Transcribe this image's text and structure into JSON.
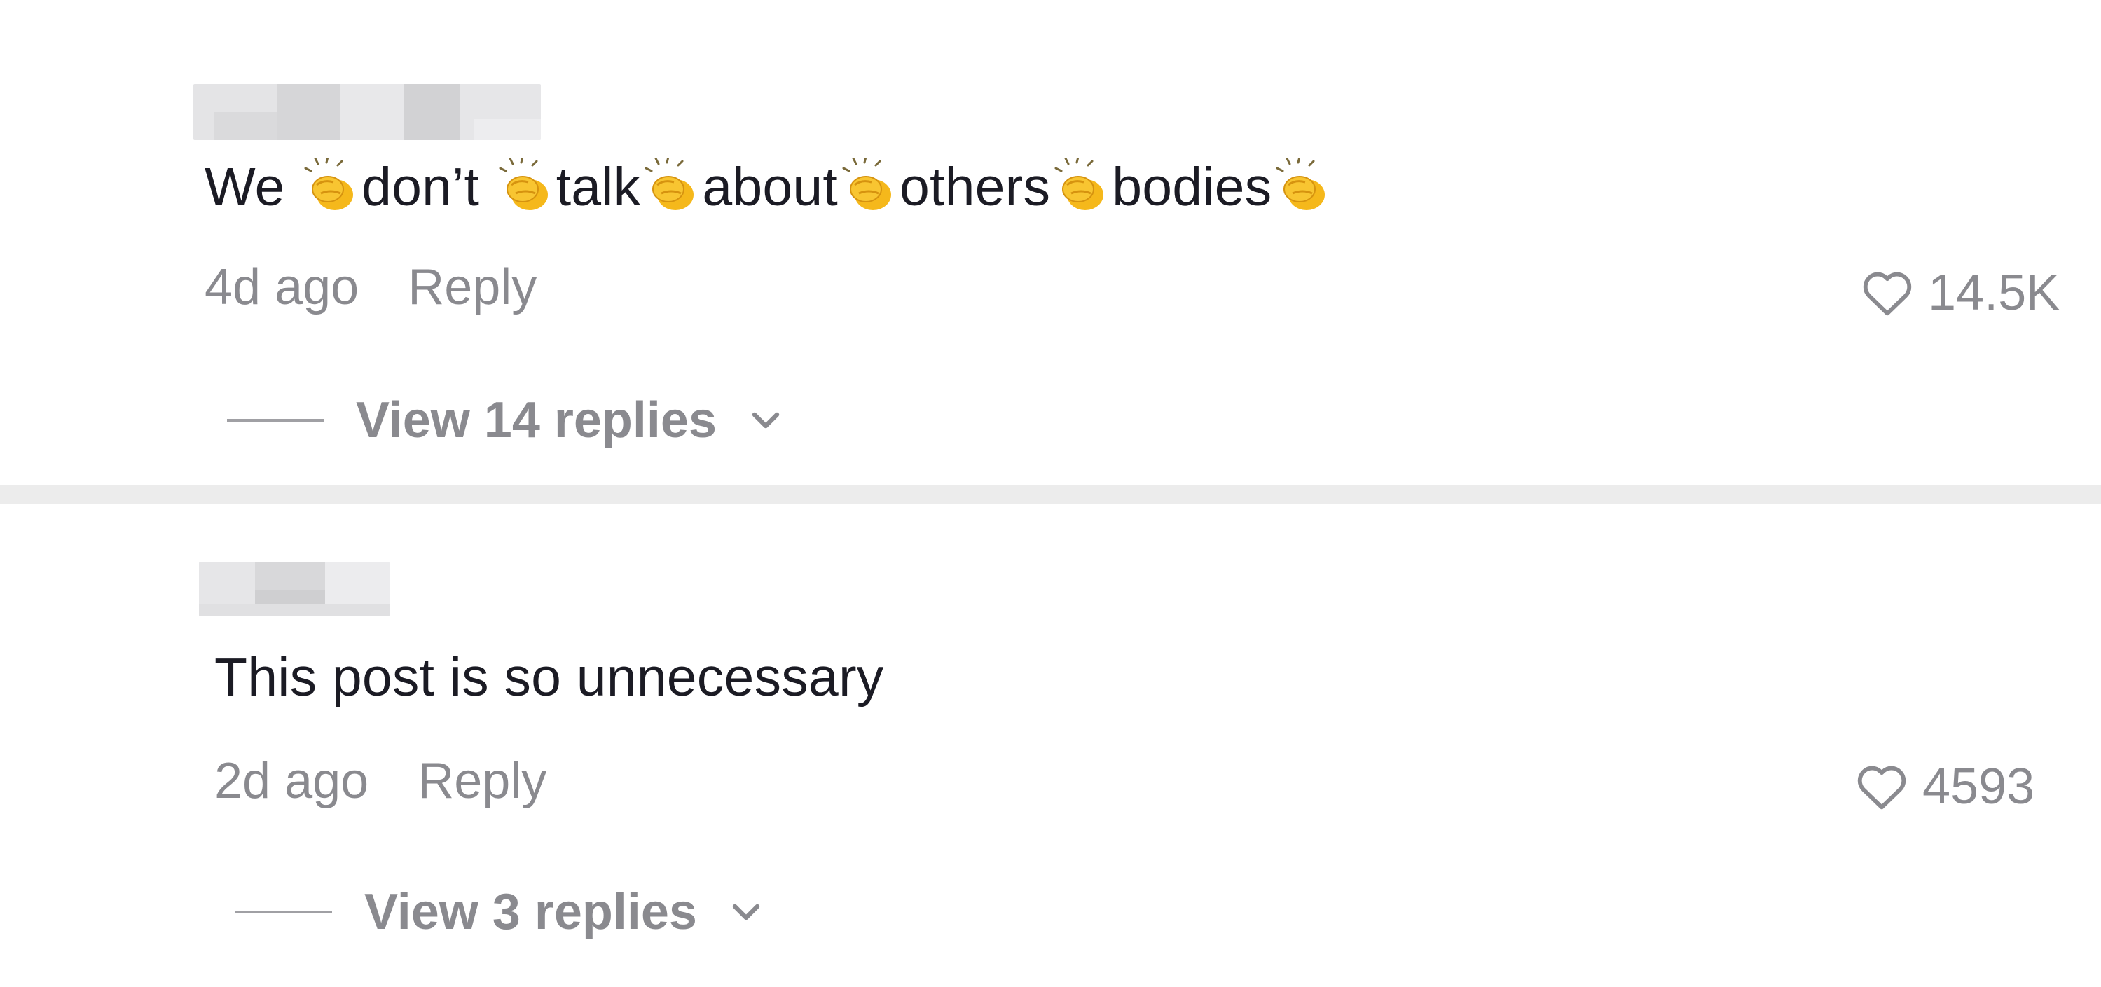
{
  "comments": [
    {
      "text_parts": [
        "We ",
        "don’t ",
        "talk",
        "about",
        "others",
        "bodies",
        ""
      ],
      "time": "4d ago",
      "reply_label": "Reply",
      "likes": "14.5K",
      "view_replies": "View 14 replies"
    },
    {
      "text": "This post is so unnecessary",
      "time": "2d ago",
      "reply_label": "Reply",
      "likes": "4593",
      "view_replies": "View 3 replies"
    }
  ],
  "icons": {
    "clap": "clapping-hands-emoji",
    "like": "heart-outline-icon",
    "expand": "chevron-down-icon"
  },
  "colors": {
    "text": "#1b1b24",
    "muted": "#8a8a8f",
    "divider": "#ececec",
    "clap_yellow": "#f5b81b"
  }
}
